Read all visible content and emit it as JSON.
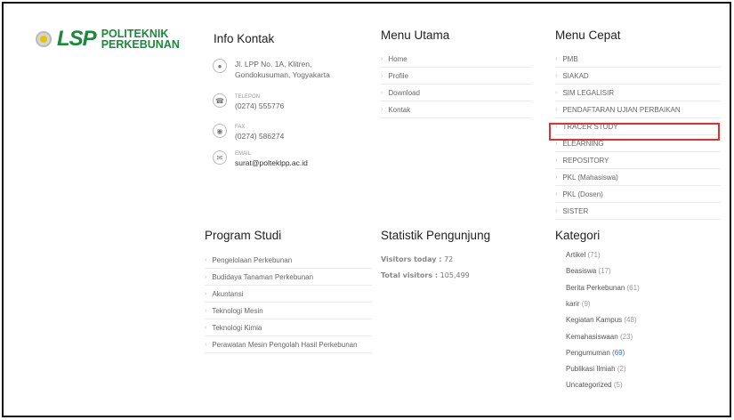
{
  "logo": {
    "mark": "LSP",
    "line1": "POLITEKNIK",
    "line2": "PERKEBUNAN"
  },
  "info_kontak": {
    "title": "Info Kontak",
    "address": {
      "line1": "Jl. LPP No. 1A, Klitren,",
      "line2": "Gondokusuman, Yogyakarta"
    },
    "telepon": {
      "label": "TELEPON",
      "value": "(0274) 555776"
    },
    "fax": {
      "label": "FAX",
      "value": "(0274) 586274"
    },
    "email": {
      "label": "EMAIL",
      "value": "surat@polteklpp.ac.id"
    }
  },
  "menu_utama": {
    "title": "Menu Utama",
    "items": [
      "Home",
      "Profile",
      "Download",
      "Kontak"
    ]
  },
  "menu_cepat": {
    "title": "Menu Cepat",
    "items": [
      "PMB",
      "SIAKAD",
      "SIM LEGALISIR",
      "PENDAFTARAN UJIAN PERBAIKAN",
      "TRACER STUDY",
      "ELEARNING",
      "REPOSITORY",
      "PKL (Mahasiswa)",
      "PKL (Dosen)",
      "SISTER"
    ]
  },
  "program_studi": {
    "title": "Program Studi",
    "items": [
      "Pengelolaan Perkebunan",
      "Budidaya Tanaman Perkebunan",
      "Akuntansi",
      "Teknologi Mesin",
      "Teknologi Kimia",
      "Perawatan Mesin Pengolah Hasil Perkebunan"
    ]
  },
  "statistik": {
    "title": "Statistik Pengunjung",
    "today_label": "Visitors today :",
    "today_value": "72",
    "total_label": "Total visitors :",
    "total_value": "105,499"
  },
  "kategori": {
    "title": "Kategori",
    "items": [
      {
        "name": "Artikel",
        "count": "(71)"
      },
      {
        "name": "Beasiswa",
        "count": "(17)"
      },
      {
        "name": "Berita Perkebunan",
        "count": "(61)"
      },
      {
        "name": "karir",
        "count": "(9)"
      },
      {
        "name": "Kegiatan Kampus",
        "count": "(48)"
      },
      {
        "name": "Kemahasiswaan",
        "count": "(23)"
      },
      {
        "name": "Pengumuman",
        "count": "(69)"
      },
      {
        "name": "Publikasi Ilmiah",
        "count": "(2)"
      },
      {
        "name": "Uncategorized",
        "count": "(5)"
      }
    ]
  },
  "colors": {
    "brand_green": "#1a8a3a",
    "highlight_red": "#e53030",
    "link_blue": "#3a6fc9"
  }
}
